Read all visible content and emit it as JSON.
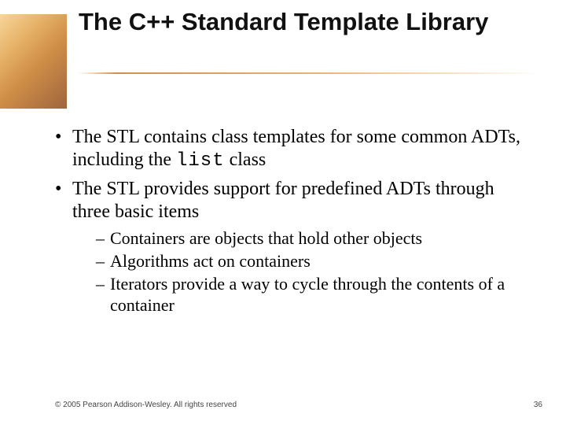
{
  "title": "The C++ Standard Template Library",
  "bullets": [
    {
      "pre": "The STL contains class templates for some common ADTs, including the ",
      "code": "list",
      "post": " class"
    },
    {
      "text": "The STL provides support for predefined ADTs through three basic items",
      "subs": [
        "Containers are objects that hold other objects",
        "Algorithms act on containers",
        "Iterators provide a way to cycle through the contents of a container"
      ]
    }
  ],
  "footer": {
    "copyright": "© 2005 Pearson Addison-Wesley. All rights reserved",
    "page": "36"
  }
}
